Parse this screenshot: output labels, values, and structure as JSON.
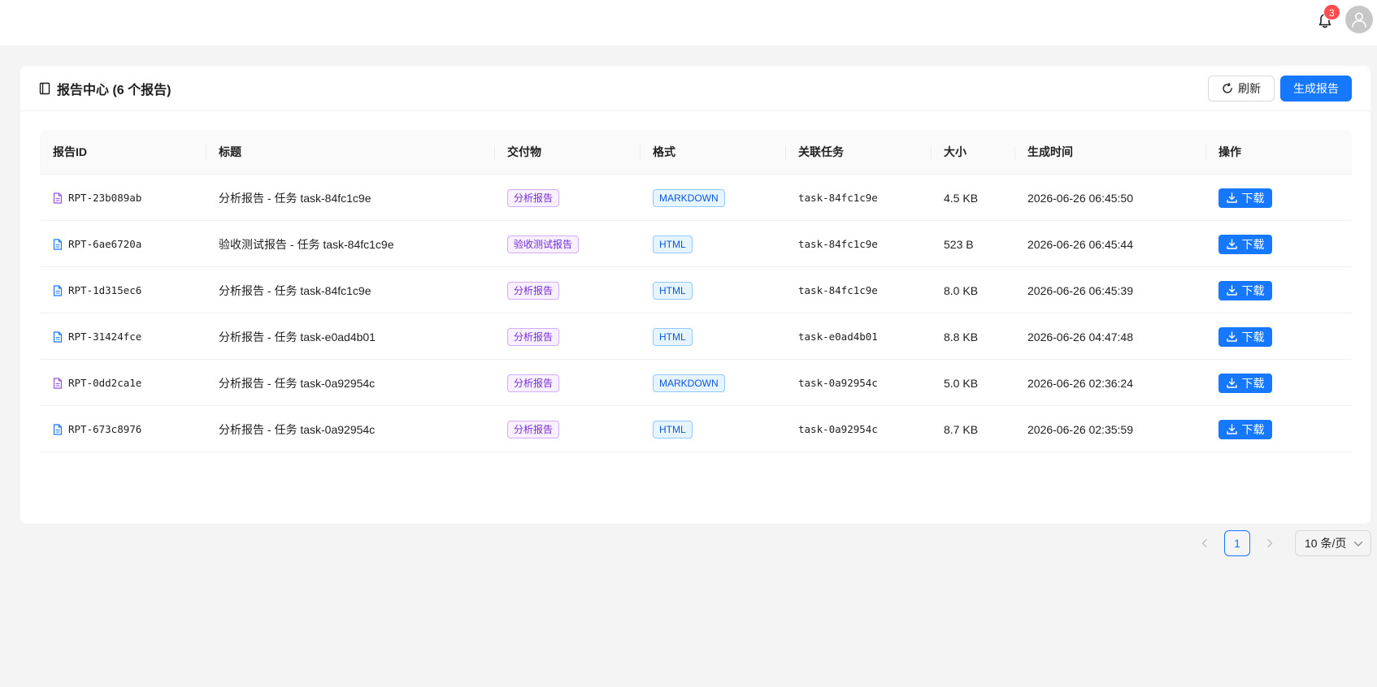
{
  "header": {
    "notification_count": "3",
    "icons": [
      "bell-icon",
      "user-avatar-icon"
    ]
  },
  "card": {
    "title": "报告中心 (6 个报告)",
    "refresh_label": "刷新",
    "generate_label": "生成报告"
  },
  "table": {
    "columns": [
      "报告ID",
      "标题",
      "交付物",
      "格式",
      "关联任务",
      "大小",
      "生成时间",
      "操作"
    ],
    "rows": [
      {
        "id": "RPT-23b089ab",
        "title": "分析报告 - 任务 task-84fc1c9e",
        "deliverable": "分析报告",
        "format": "MARKDOWN",
        "task": "task-84fc1c9e",
        "size": "4.5 KB",
        "time": "2026-06-26 06:45:50",
        "action": "下载"
      },
      {
        "id": "RPT-6ae6720a",
        "title": "验收测试报告 - 任务 task-84fc1c9e",
        "deliverable": "验收测试报告",
        "format": "HTML",
        "task": "task-84fc1c9e",
        "size": "523 B",
        "time": "2026-06-26 06:45:44",
        "action": "下载"
      },
      {
        "id": "RPT-1d315ec6",
        "title": "分析报告 - 任务 task-84fc1c9e",
        "deliverable": "分析报告",
        "format": "HTML",
        "task": "task-84fc1c9e",
        "size": "8.0 KB",
        "time": "2026-06-26 06:45:39",
        "action": "下载"
      },
      {
        "id": "RPT-31424fce",
        "title": "分析报告 - 任务 task-e0ad4b01",
        "deliverable": "分析报告",
        "format": "HTML",
        "task": "task-e0ad4b01",
        "size": "8.8 KB",
        "time": "2026-06-26 04:47:48",
        "action": "下载"
      },
      {
        "id": "RPT-0dd2ca1e",
        "title": "分析报告 - 任务 task-0a92954c",
        "deliverable": "分析报告",
        "format": "MARKDOWN",
        "task": "task-0a92954c",
        "size": "5.0 KB",
        "time": "2026-06-26 02:36:24",
        "action": "下载"
      },
      {
        "id": "RPT-673c8976",
        "title": "分析报告 - 任务 task-0a92954c",
        "deliverable": "分析报告",
        "format": "HTML",
        "task": "task-0a92954c",
        "size": "8.7 KB",
        "time": "2026-06-26 02:35:59",
        "action": "下载"
      }
    ]
  },
  "pagination": {
    "current_page": "1",
    "page_size": "10 条/页"
  },
  "colors": {
    "primary": "#1677ff",
    "badge": "#ff4d4f",
    "markdown_icon": "#9254de",
    "html_icon": "#1677ff"
  }
}
